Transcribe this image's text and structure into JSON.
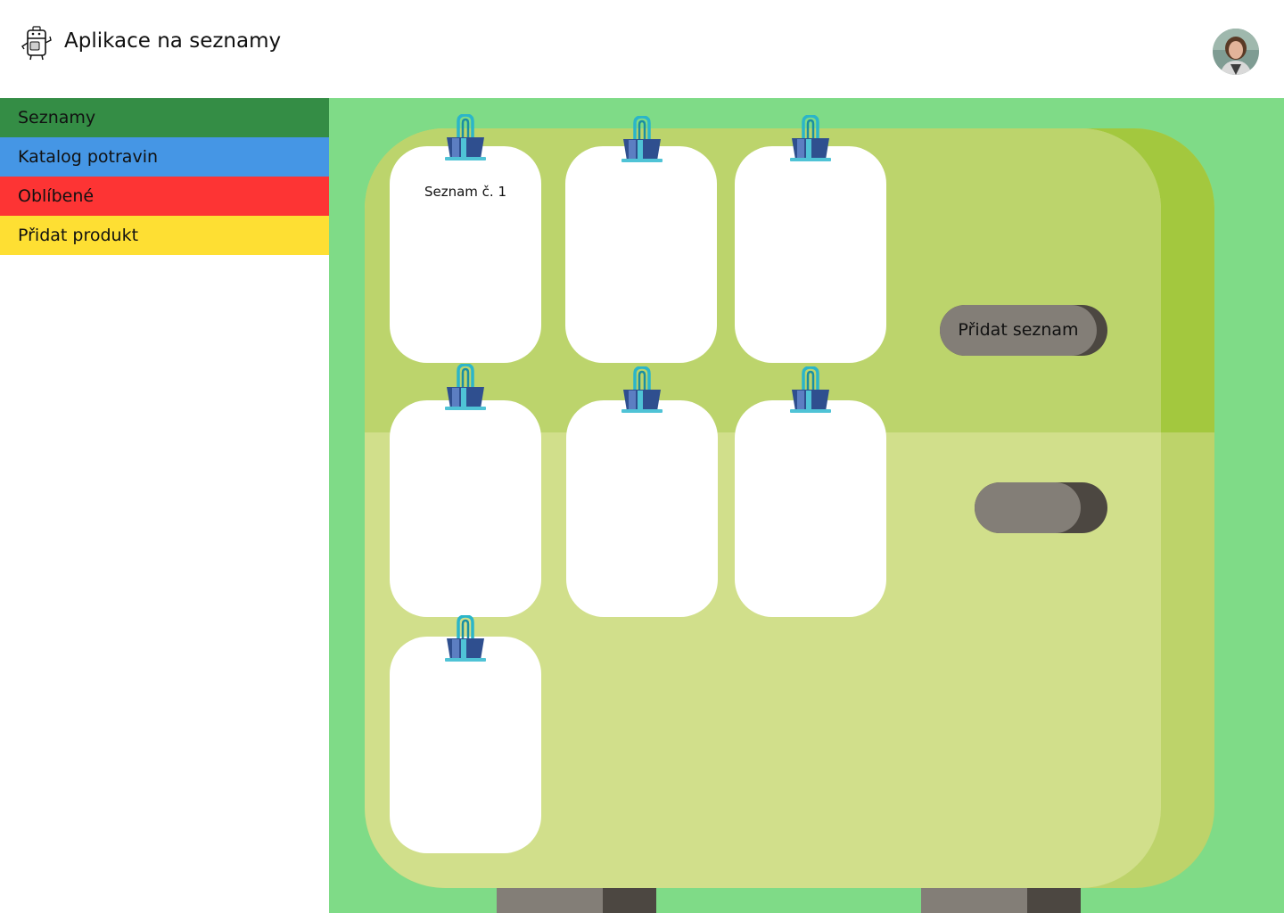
{
  "header": {
    "title": "Aplikace na seznamy",
    "logo_icon": "fridge-mascot-icon",
    "avatar_icon": "user-avatar-icon"
  },
  "sidebar": {
    "items": [
      {
        "label": "Seznamy",
        "color": "#348d45"
      },
      {
        "label": "Katalog potravin",
        "color": "#4596e5"
      },
      {
        "label": "Oblíbené",
        "color": "#fd3434"
      },
      {
        "label": "Přidat produkt",
        "color": "#fedf33"
      }
    ]
  },
  "main": {
    "lists": [
      {
        "title": "Seznam č. 1"
      },
      {
        "title": ""
      },
      {
        "title": ""
      },
      {
        "title": ""
      },
      {
        "title": ""
      },
      {
        "title": ""
      },
      {
        "title": ""
      }
    ],
    "add_list_label": "Přidat seznam",
    "second_button_label": ""
  },
  "colors": {
    "background_green": "#7fdb87",
    "fridge_top": "#bcd46c",
    "fridge_bottom": "#d1df8b",
    "button_face": "#837e77",
    "button_shadow": "#4c4741"
  }
}
